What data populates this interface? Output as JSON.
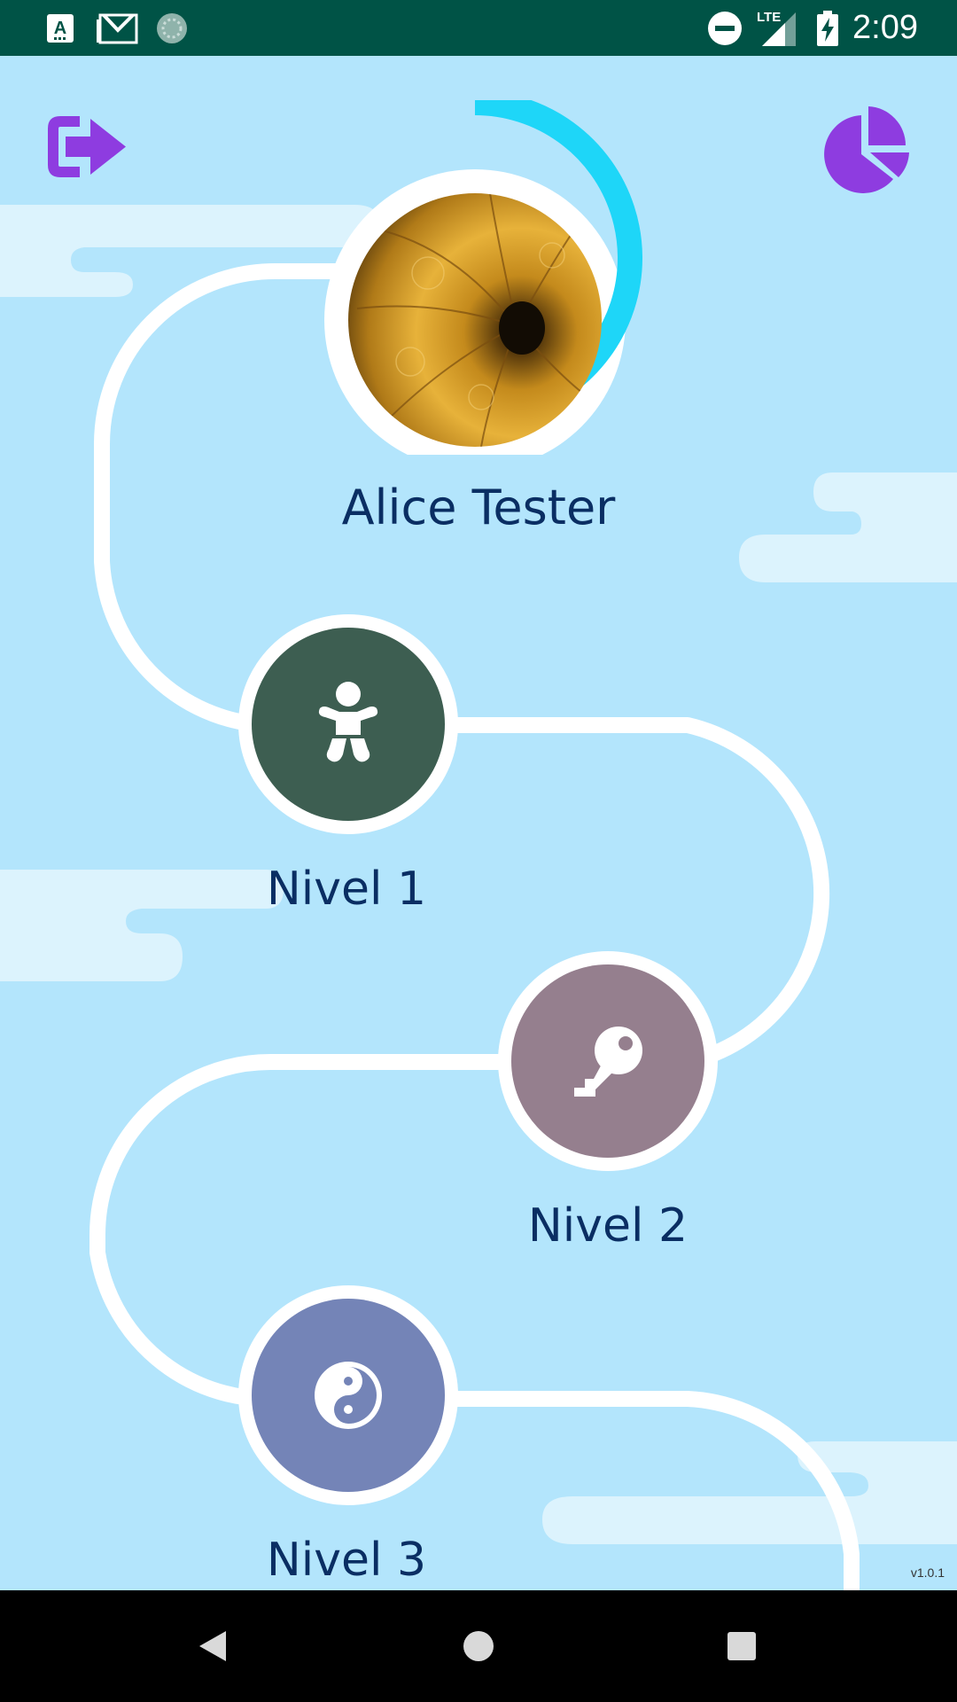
{
  "status_bar": {
    "time": "2:09",
    "network": "LTE",
    "left_icons": [
      "a-notification-icon",
      "gmail-icon",
      "sync-icon"
    ],
    "right_icons": [
      "do-not-disturb-icon",
      "signal-icon",
      "battery-charging-icon"
    ],
    "background_color": "#005346"
  },
  "header": {
    "logout_icon": "logout-icon",
    "stats_icon": "pie-chart-icon",
    "icon_color": "#8e3ce0"
  },
  "profile": {
    "name": "Alice Tester",
    "progress_ring_color": "#1ed6f8",
    "progress_fraction": 0.4
  },
  "levels": [
    {
      "label": "Nivel 1",
      "icon": "baby-icon",
      "color": "#3d5e51"
    },
    {
      "label": "Nivel 2",
      "icon": "key-icon",
      "color": "#957f8e"
    },
    {
      "label": "Nivel 3",
      "icon": "yin-yang-icon",
      "color": "#7484b7"
    }
  ],
  "version": "v1.0.1",
  "nav_bar": {
    "buttons": [
      "back-icon",
      "home-icon",
      "recents-icon"
    ]
  },
  "colors": {
    "background": "#b3e5fc",
    "path": "#ffffff",
    "text": "#0a2e63",
    "cloud": "#dcf3fd"
  }
}
